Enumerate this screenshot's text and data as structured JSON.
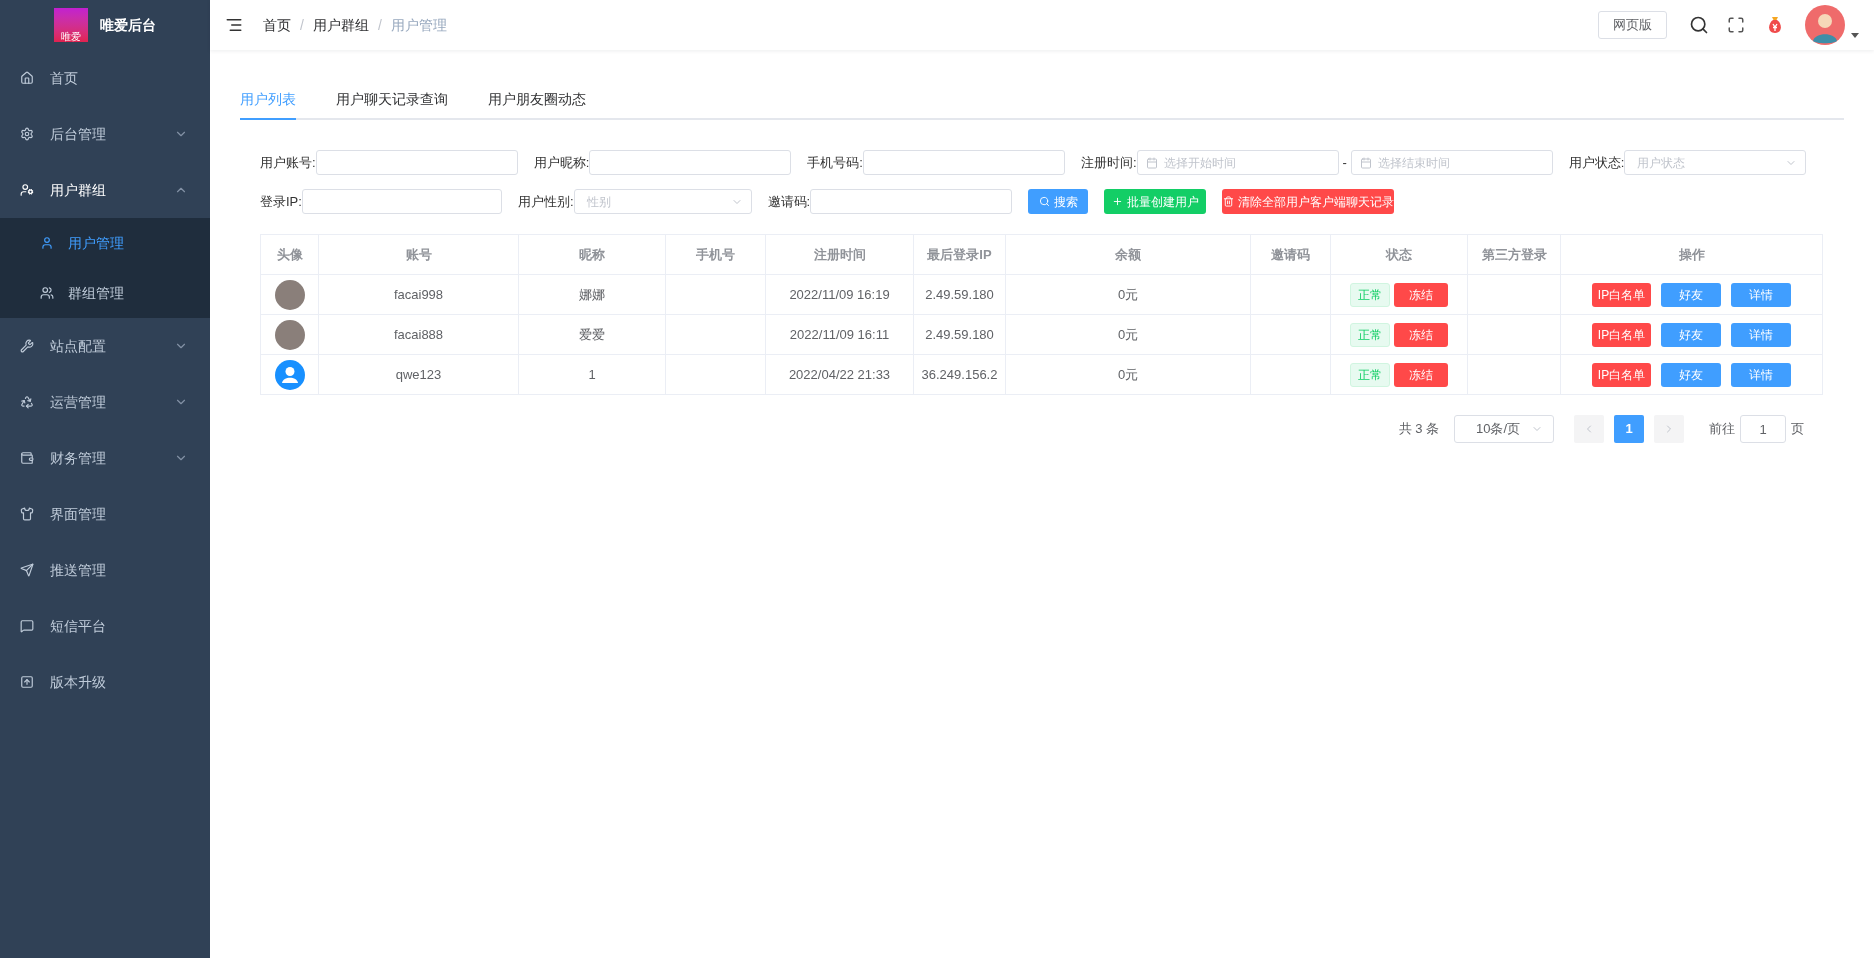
{
  "sidebar": {
    "logo_text": "唯爱",
    "title": "唯爱后台",
    "items": [
      {
        "label": "首页",
        "kind": "link",
        "selected": false
      },
      {
        "label": "后台管理",
        "kind": "group",
        "expanded": false,
        "selected": false
      },
      {
        "label": "用户群组",
        "kind": "group",
        "expanded": true,
        "selected": false,
        "children": [
          {
            "label": "用户管理",
            "selected": true
          },
          {
            "label": "群组管理",
            "selected": false
          }
        ]
      },
      {
        "label": "站点配置",
        "kind": "group",
        "expanded": false,
        "selected": false
      },
      {
        "label": "运营管理",
        "kind": "group",
        "expanded": false,
        "selected": false
      },
      {
        "label": "财务管理",
        "kind": "group",
        "expanded": false,
        "selected": false
      },
      {
        "label": "界面管理",
        "kind": "link",
        "selected": false
      },
      {
        "label": "推送管理",
        "kind": "link",
        "selected": false
      },
      {
        "label": "短信平台",
        "kind": "link",
        "selected": false
      },
      {
        "label": "版本升级",
        "kind": "link",
        "selected": false
      }
    ]
  },
  "header": {
    "separator": "/",
    "breadcrumb": [
      {
        "label": "首页",
        "current": false
      },
      {
        "label": "用户群组",
        "current": false
      },
      {
        "label": "用户管理",
        "current": true
      }
    ],
    "web_button": "网页版"
  },
  "tabs": [
    {
      "label": "用户列表",
      "selected": true
    },
    {
      "label": "用户聊天记录查询",
      "selected": false
    },
    {
      "label": "用户朋友圈动态",
      "selected": false
    }
  ],
  "filter_rows": [
    {
      "fields": [
        {
          "kind": "text",
          "label": "用户账号:"
        },
        {
          "kind": "text",
          "label": "用户昵称:"
        },
        {
          "kind": "text",
          "label": "手机号码:"
        },
        {
          "kind": "date_range",
          "label": "注册时间:",
          "placeholder": "选择开始时间",
          "separator": "-",
          "placeholder_end": "选择结束时间"
        },
        {
          "kind": "select",
          "label": "用户状态:",
          "placeholder": "用户状态"
        }
      ],
      "buttons": []
    },
    {
      "fields": [
        {
          "kind": "text",
          "label": "登录IP:"
        },
        {
          "kind": "select",
          "label": "用户性别:",
          "placeholder": "性别"
        },
        {
          "kind": "text",
          "label": "邀请码:"
        }
      ],
      "buttons": [
        {
          "kind": "search",
          "label": "搜索"
        },
        {
          "kind": "create",
          "label": "批量创建用户"
        },
        {
          "kind": "clear",
          "label": "清除全部用户客户端聊天记录"
        }
      ]
    }
  ],
  "table": {
    "columns": [
      "头像",
      "账号",
      "昵称",
      "手机号",
      "注册时间",
      "最后登录IP",
      "余额",
      "邀请码",
      "状态",
      "第三方登录",
      "操作"
    ],
    "rows": [
      {
        "kind": "photo",
        "account": "facai998",
        "nickname": "娜娜",
        "registered": "2022/11/09 16:19",
        "last_ip": "2.49.59.180",
        "balance": "0元",
        "status_tag": "正常",
        "status_button": "冻结",
        "actions": [
          {
            "kind": "danger",
            "label": "IP白名单"
          },
          {
            "kind": "primary",
            "label": "好友"
          },
          {
            "kind": "primary",
            "label": "详情"
          }
        ]
      },
      {
        "kind": "photo",
        "account": "facai888",
        "nickname": "爱爱",
        "registered": "2022/11/09 16:11",
        "last_ip": "2.49.59.180",
        "balance": "0元",
        "status_tag": "正常",
        "status_button": "冻结",
        "actions": [
          {
            "kind": "danger",
            "label": "IP白名单"
          },
          {
            "kind": "primary",
            "label": "好友"
          },
          {
            "kind": "primary",
            "label": "详情"
          }
        ]
      },
      {
        "kind": "default",
        "account": "qwe123",
        "nickname": "1",
        "registered": "2022/04/22 21:33",
        "last_ip": "36.249.156.2",
        "balance": "0元",
        "status_tag": "正常",
        "status_button": "冻结",
        "actions": [
          {
            "kind": "danger",
            "label": "IP白名单"
          },
          {
            "kind": "primary",
            "label": "好友"
          },
          {
            "kind": "primary",
            "label": "详情"
          }
        ]
      }
    ]
  },
  "pagination": {
    "total": "共 3 条",
    "page_size": "10条/页",
    "pages": [
      {
        "label": "1",
        "selected": true
      }
    ],
    "goto_label": "前往",
    "goto_value": "1",
    "goto_suffix": "页"
  }
}
